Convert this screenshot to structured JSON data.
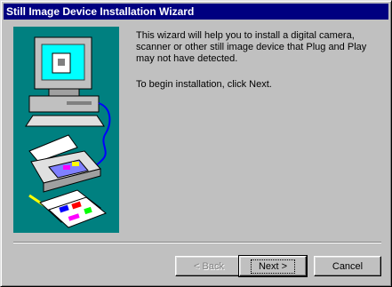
{
  "window": {
    "title": "Still Image Device Installation Wizard"
  },
  "content": {
    "intro": "This wizard will help you to install a digital camera, scanner or other still image device that Plug and Play may not have detected.",
    "instruction": "To begin installation, click Next."
  },
  "buttons": {
    "back_label": "< Back",
    "next_label": "Next >",
    "cancel_label": "Cancel"
  },
  "colors": {
    "titlebar": "#000080",
    "panel": "#008080",
    "face": "#c0c0c0"
  },
  "illustration": {
    "icons": [
      "computer-icon",
      "scanner-icon",
      "printed-photos-icon"
    ]
  }
}
